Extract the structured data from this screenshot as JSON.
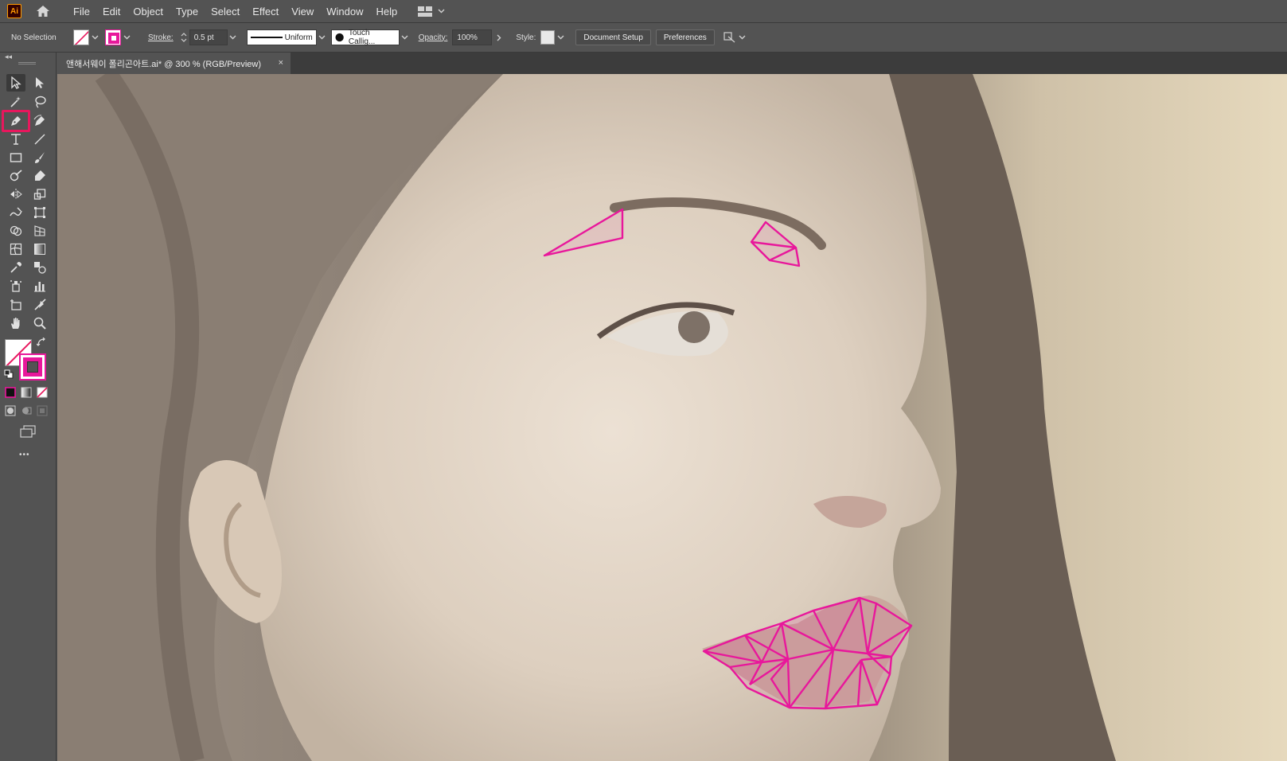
{
  "app": {
    "logo_text": "Ai"
  },
  "menu": [
    "File",
    "Edit",
    "Object",
    "Type",
    "Select",
    "Effect",
    "View",
    "Window",
    "Help"
  ],
  "control_bar": {
    "selection_label": "No Selection",
    "stroke_label": "Stroke:",
    "stroke_value": "0.5 pt",
    "profile_label": "Uniform",
    "brush_label": "Touch Callig...",
    "opacity_label": "Opacity:",
    "opacity_value": "100%",
    "style_label": "Style:",
    "document_setup": "Document Setup",
    "preferences": "Preferences"
  },
  "document_tab": {
    "title": "앤해서웨이 폴리곤아트.ai* @ 300 % (RGB/Preview)",
    "close_glyph": "×"
  },
  "toolbar": {
    "more_glyph": "•••"
  },
  "colors": {
    "accent": "#e8179b",
    "stroke_highlight": "#e8175d"
  },
  "tools": [
    "selection-tool",
    "direct-selection-tool",
    "magic-wand-tool",
    "lasso-tool",
    "pen-tool",
    "curvature-tool",
    "type-tool",
    "line-segment-tool",
    "rectangle-tool",
    "paintbrush-tool",
    "shaper-tool",
    "eraser-tool",
    "reflect-tool",
    "scale-tool",
    "warp-tool",
    "free-transform-tool",
    "shape-builder-tool",
    "perspective-grid-tool",
    "mesh-tool",
    "gradient-tool",
    "eyedropper-tool",
    "blend-tool",
    "symbol-sprayer-tool",
    "column-graph-tool",
    "artboard-tool",
    "slice-tool",
    "hand-tool",
    "zoom-tool"
  ]
}
